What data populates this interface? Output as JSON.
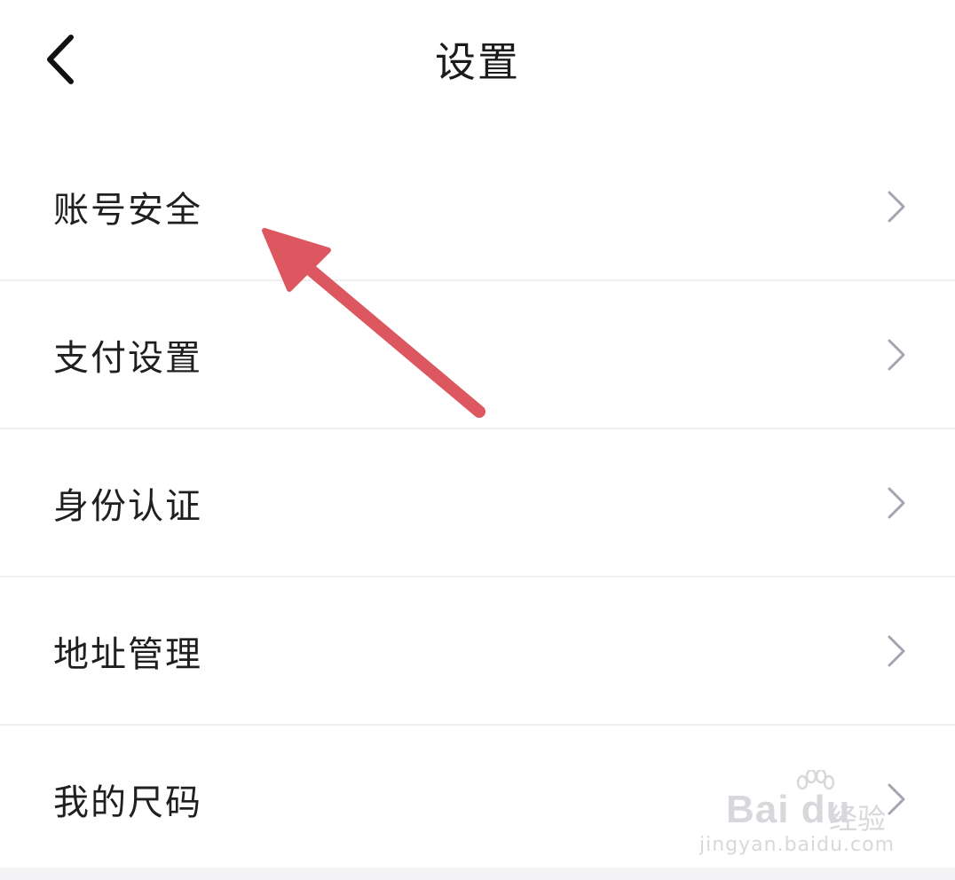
{
  "header": {
    "title": "设置",
    "back_icon": "back-chevron-icon"
  },
  "menu": {
    "items": [
      {
        "label": "账号安全",
        "icon": "chevron-right-icon"
      },
      {
        "label": "支付设置",
        "icon": "chevron-right-icon"
      },
      {
        "label": "身份认证",
        "icon": "chevron-right-icon"
      },
      {
        "label": "地址管理",
        "icon": "chevron-right-icon"
      },
      {
        "label": "我的尺码",
        "icon": "chevron-right-icon"
      }
    ]
  },
  "annotation": {
    "arrow_color": "#dc5760"
  },
  "watermark": {
    "logo": "Bai du",
    "text": "经验",
    "url": "jingyan.baidu.com"
  },
  "colors": {
    "title_text": "#1b1b1b",
    "item_text": "#1f1f1f",
    "chevron": "#a4a4b0",
    "divider": "#efeff2"
  }
}
